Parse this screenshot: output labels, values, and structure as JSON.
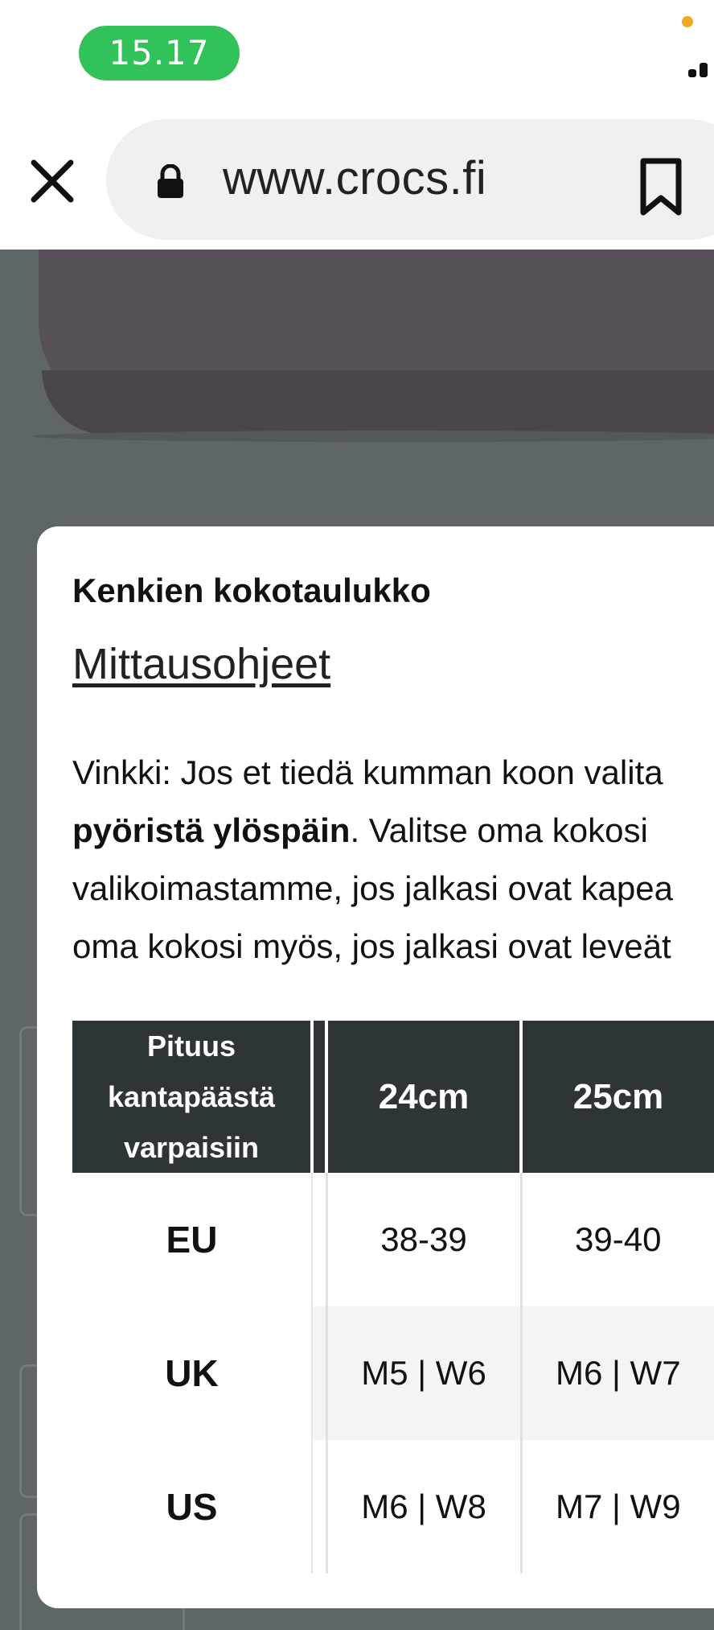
{
  "status_bar": {
    "time": "15.17"
  },
  "browser": {
    "url": "www.crocs.fi"
  },
  "modal": {
    "title": "Kenkien kokotaulukko",
    "link": "Mittausohjeet",
    "tip": {
      "line1": "Vinkki: Jos et tiedä kumman koon valita",
      "line2_bold": "pyöristä ylöspäin",
      "line2_rest": ". Valitse oma kokosi",
      "line3": "valikoimastamme, jos jalkasi ovat kapea",
      "line4": "oma kokosi myös, jos jalkasi ovat leveät"
    },
    "table": {
      "header_label": [
        "Pituus",
        "kantapäästä",
        "varpaisiin"
      ],
      "columns": [
        "24cm",
        "25cm"
      ],
      "rows": [
        {
          "label": "EU",
          "values": [
            "38-39",
            "39-40"
          ]
        },
        {
          "label": "UK",
          "values": [
            "M5 | W6",
            "M6 | W7"
          ]
        },
        {
          "label": "US",
          "values": [
            "M6 | W8",
            "M7 | W9"
          ]
        }
      ]
    }
  },
  "colors": {
    "time_pill": "#32c25a",
    "table_header": "#2e3538",
    "overlay": "#5f6668"
  }
}
